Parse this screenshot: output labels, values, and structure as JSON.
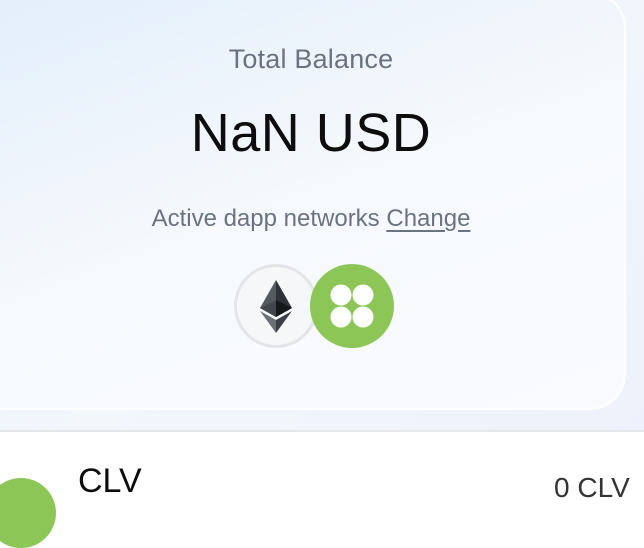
{
  "balance": {
    "label": "Total Balance",
    "value": "NaN USD"
  },
  "networks": {
    "label": "Active dapp networks",
    "change_link": "Change",
    "icons": [
      "ethereum-icon",
      "clover-icon"
    ]
  },
  "token_list": {
    "items": [
      {
        "symbol": "CLV",
        "balance": "0 CLV",
        "icon": "clover-icon"
      }
    ]
  },
  "colors": {
    "clover_green": "#8cc657",
    "text_primary": "#0d0d0d",
    "text_secondary": "#6b7280"
  }
}
